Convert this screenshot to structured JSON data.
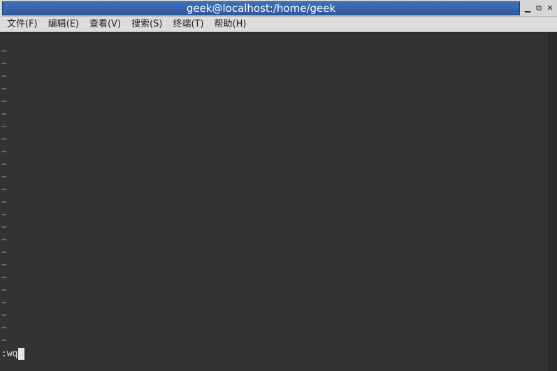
{
  "window": {
    "title": "geek@localhost:/home/geek",
    "buttons": [
      "▁",
      "⧉",
      "✕"
    ]
  },
  "menubar": {
    "items": [
      "文件(F)",
      "编辑(E)",
      "查看(V)",
      "搜索(S)",
      "终端(T)",
      "帮助(H)"
    ]
  },
  "terminal": {
    "empty_line_marker": "~",
    "empty_line_count": 24,
    "command": ":wq",
    "colors": {
      "background": "#333333",
      "tilde": "#6f8fbf",
      "text": "#e6e6e6"
    }
  }
}
